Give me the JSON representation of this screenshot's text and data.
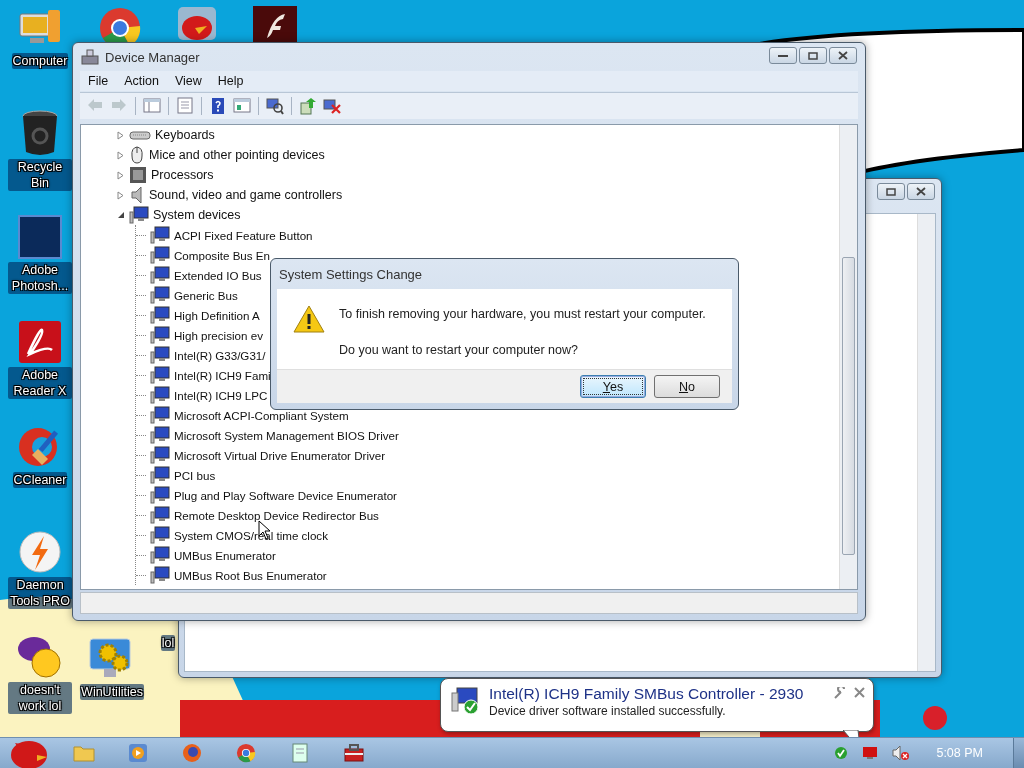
{
  "desktop_icons": [
    {
      "kind": "computer",
      "label": "Computer"
    },
    {
      "kind": "bin",
      "label": "Recycle Bin"
    },
    {
      "kind": "ps",
      "label": "Adobe Photosh..."
    },
    {
      "kind": "pdf",
      "label": "Adobe Reader X"
    },
    {
      "kind": "cleaner",
      "label": "CCleaner"
    },
    {
      "kind": "bolt",
      "label": "Daemon Tools PRO"
    },
    {
      "kind": "smiley",
      "label": "doesn't work lol"
    },
    {
      "kind": "browser"
    },
    {
      "kind": "bird"
    },
    {
      "kind": "flash"
    },
    {
      "kind": "gears",
      "label": "WinUtilities"
    },
    {
      "kind": "blank",
      "label": "lol"
    }
  ],
  "device_manager": {
    "title": "Device Manager",
    "menu": [
      "File",
      "Action",
      "View",
      "Help"
    ],
    "toolbar": [
      {
        "kind": "back",
        "disabled": true
      },
      {
        "kind": "forward",
        "disabled": true
      },
      {
        "kind": "pane",
        "disabled": false
      },
      {
        "kind": "properties",
        "disabled": false
      },
      {
        "kind": "help",
        "disabled": false
      },
      {
        "kind": "view",
        "disabled": false
      },
      {
        "kind": "scan",
        "disabled": false
      },
      {
        "kind": "update",
        "disabled": false
      },
      {
        "kind": "uninstall",
        "disabled": false
      }
    ],
    "tree": [
      {
        "label": "Keyboards",
        "kind": "keyboard",
        "expanded": false
      },
      {
        "label": "Mice and other pointing devices",
        "kind": "mouse",
        "expanded": false
      },
      {
        "label": "Processors",
        "kind": "chip",
        "expanded": false
      },
      {
        "label": "Sound, video and game controllers",
        "kind": "speaker",
        "expanded": false
      },
      {
        "label": "System devices",
        "kind": "computer",
        "expanded": true,
        "children": [
          {
            "label": "ACPI Fixed Feature Button"
          },
          {
            "label": "Composite Bus En"
          },
          {
            "label": "Extended IO Bus"
          },
          {
            "label": "Generic Bus"
          },
          {
            "label": "High Definition A"
          },
          {
            "label": "High precision ev"
          },
          {
            "label": "Intel(R) G33/G31/"
          },
          {
            "label": "Intel(R) ICH9 Fami"
          },
          {
            "label": "Intel(R) ICH9 LPC"
          },
          {
            "label": "Microsoft ACPI-Compliant System"
          },
          {
            "label": "Microsoft System Management BIOS Driver"
          },
          {
            "label": "Microsoft Virtual Drive Enumerator Driver"
          },
          {
            "label": "PCI bus"
          },
          {
            "label": "Plug and Play Software Device Enumerator"
          },
          {
            "label": "Remote Desktop Device Redirector Bus"
          },
          {
            "label": "System CMOS/real time clock"
          },
          {
            "label": "UMBus Enumerator"
          },
          {
            "label": "UMBus Root Bus Enumerator"
          }
        ]
      }
    ]
  },
  "dialog": {
    "title": "System Settings Change",
    "message": "To finish removing your hardware, you must restart your computer.",
    "question": "Do you want to restart your computer now?",
    "buttons": [
      {
        "label": "Yes",
        "default": true
      },
      {
        "label": "No",
        "default": false
      }
    ]
  },
  "notification": {
    "title": "Intel(R) ICH9 Family SMBus Controller - 2930",
    "message": "Device driver software installed successfully."
  },
  "taskbar": {
    "pinned": [
      {
        "kind": "folder"
      },
      {
        "kind": "media"
      },
      {
        "kind": "firefox"
      },
      {
        "kind": "browser"
      },
      {
        "kind": "notepad"
      },
      {
        "kind": "toolbox"
      }
    ],
    "tray": [
      {
        "kind": "check"
      },
      {
        "kind": "display"
      },
      {
        "kind": "mute"
      }
    ],
    "clock": "5:08 PM"
  }
}
